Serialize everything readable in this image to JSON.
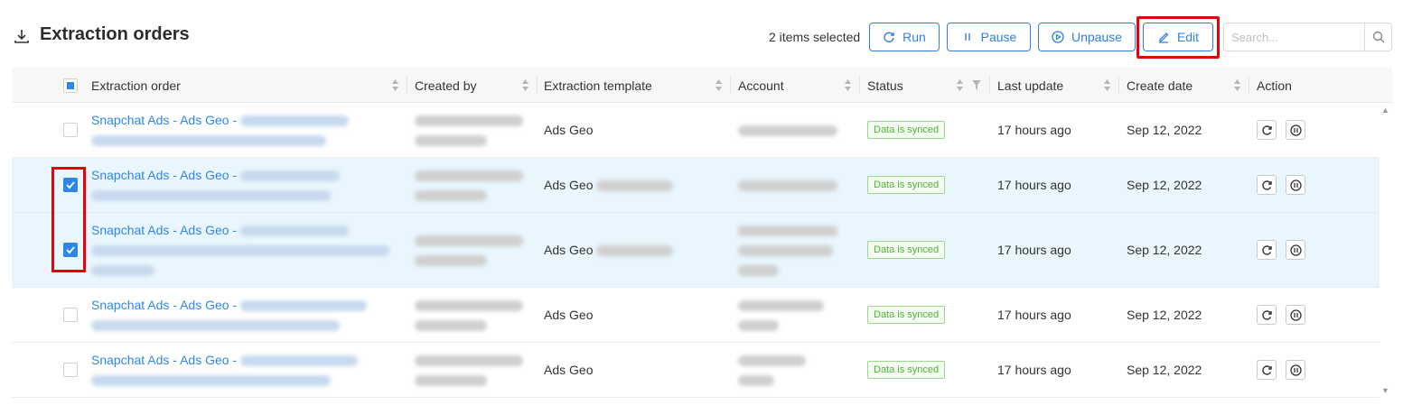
{
  "header": {
    "title": "Extraction orders",
    "selected_text": "2 items selected",
    "buttons": {
      "run": "Run",
      "pause": "Pause",
      "unpause": "Unpause",
      "edit": "Edit"
    },
    "search_placeholder": "Search..."
  },
  "columns": [
    "Extraction order",
    "Created by",
    "Extraction template",
    "Account",
    "Status",
    "Last update",
    "Create date",
    "Action"
  ],
  "rows": [
    {
      "order": "Snapchat Ads - Ads Geo -",
      "template": "Ads Geo",
      "status": "Data is synced",
      "last_update": "17 hours ago",
      "create_date": "Sep 12, 2022",
      "checked": false
    },
    {
      "order": "Snapchat Ads - Ads Geo -",
      "template": "Ads Geo",
      "status": "Data is synced",
      "last_update": "17 hours ago",
      "create_date": "Sep 12, 2022",
      "checked": true
    },
    {
      "order": "Snapchat Ads - Ads Geo -",
      "template": "Ads Geo",
      "status": "Data is synced",
      "last_update": "17 hours ago",
      "create_date": "Sep 12, 2022",
      "checked": true
    },
    {
      "order": "Snapchat Ads - Ads Geo -",
      "template": "Ads Geo",
      "status": "Data is synced",
      "last_update": "17 hours ago",
      "create_date": "Sep 12, 2022",
      "checked": false
    },
    {
      "order": "Snapchat Ads - Ads Geo -",
      "template": "Ads Geo",
      "status": "Data is synced",
      "last_update": "17 hours ago",
      "create_date": "Sep 12, 2022",
      "checked": false
    }
  ],
  "colors": {
    "primary": "#2f86ea",
    "highlight": "#e8000b",
    "status_green": "#52b03a",
    "selected_row": "#e9f6fd"
  }
}
